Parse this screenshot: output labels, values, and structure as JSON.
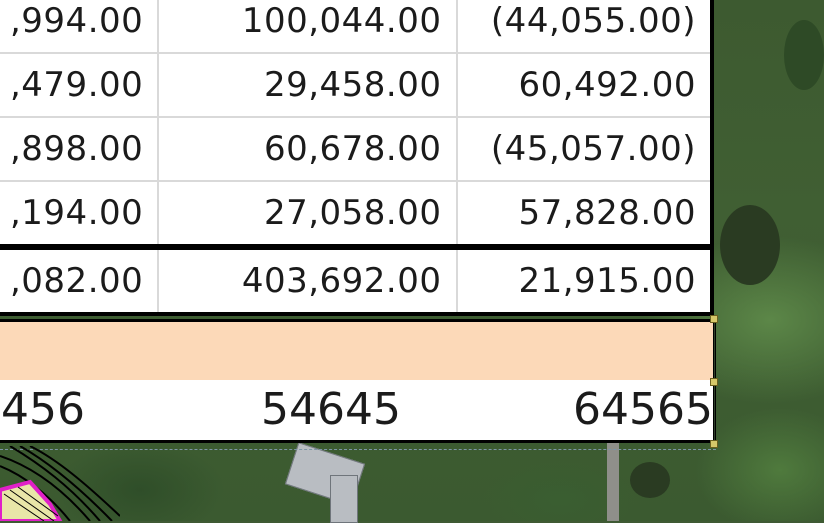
{
  "table": {
    "rows": [
      {
        "c1": ",994.00",
        "c2": "100,044.00",
        "c3": "(44,055.00)"
      },
      {
        "c1": ",479.00",
        "c2": "29,458.00",
        "c3": "60,492.00"
      },
      {
        "c1": ",898.00",
        "c2": "60,678.00",
        "c3": "(45,057.00)"
      },
      {
        "c1": ",194.00",
        "c2": "27,058.00",
        "c3": "57,828.00"
      }
    ],
    "total": {
      "c1": ",082.00",
      "c2": "403,692.00",
      "c3": "21,915.00"
    }
  },
  "lower": {
    "values": [
      "456",
      "54645",
      "64565"
    ],
    "bar_color": "#fcd9b8"
  },
  "colors": {
    "grid": "#d9d9d9",
    "selection_handle": "#d6c86a",
    "magenta_parcel": "#e020c8"
  }
}
